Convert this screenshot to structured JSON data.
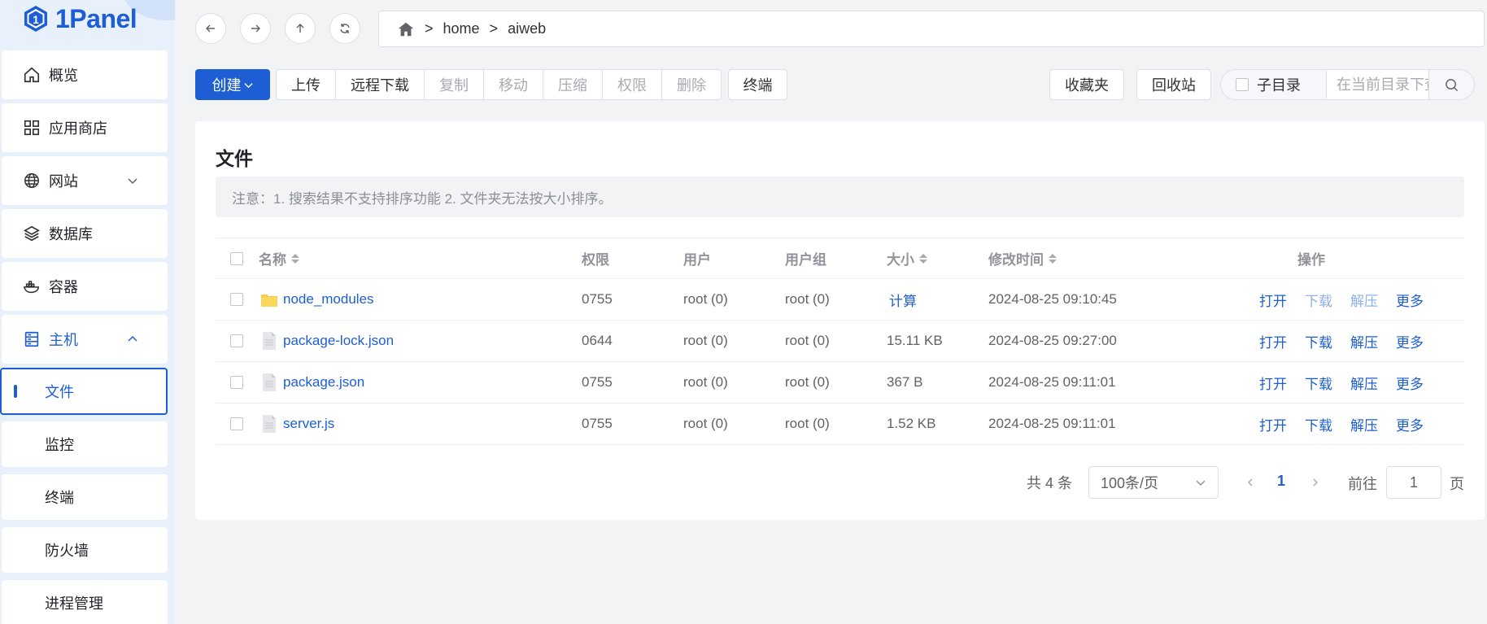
{
  "app": {
    "logo_text": "1Panel"
  },
  "sidebar": {
    "items": [
      {
        "label": "概览",
        "icon": "home-icon"
      },
      {
        "label": "应用商店",
        "icon": "grid-icon"
      },
      {
        "label": "网站",
        "icon": "globe-icon"
      },
      {
        "label": "数据库",
        "icon": "layers-icon"
      },
      {
        "label": "容器",
        "icon": "docker-icon"
      },
      {
        "label": "主机",
        "icon": "server-icon"
      }
    ],
    "sub_items": [
      "文件",
      "监控",
      "终端",
      "防火墙",
      "进程管理"
    ],
    "active": "文件"
  },
  "path": {
    "segments": [
      "home",
      "aiweb"
    ],
    "separator": ">"
  },
  "toolbar": {
    "create": "创建",
    "upload": "上传",
    "remote_download": "远程下载",
    "copy": "复制",
    "move": "移动",
    "compress": "压缩",
    "permission": "权限",
    "delete": "删除",
    "terminal": "终端",
    "favorites": "收藏夹",
    "recycle_bin": "回收站",
    "subdir": "子目录",
    "search_placeholder": "在当前目录下查找"
  },
  "card": {
    "title": "文件",
    "notice": "注意：1. 搜索结果不支持排序功能 2. 文件夹无法按大小排序。"
  },
  "table": {
    "headers": {
      "name": "名称",
      "mode": "权限",
      "user": "用户",
      "group": "用户组",
      "size": "大小",
      "mtime": "修改时间",
      "ops": "操作"
    },
    "rows": [
      {
        "name": "node_modules",
        "type": "folder",
        "mode": "0755",
        "user": "root (0)",
        "group": "root (0)",
        "size": "计算",
        "mtime": "2024-08-25 09:10:45"
      },
      {
        "name": "package-lock.json",
        "type": "file",
        "mode": "0644",
        "user": "root (0)",
        "group": "root (0)",
        "size": "15.11 KB",
        "mtime": "2024-08-25 09:27:00"
      },
      {
        "name": "package.json",
        "type": "file",
        "mode": "0755",
        "user": "root (0)",
        "group": "root (0)",
        "size": "367 B",
        "mtime": "2024-08-25 09:11:01"
      },
      {
        "name": "server.js",
        "type": "file",
        "mode": "0755",
        "user": "root (0)",
        "group": "root (0)",
        "size": "1.52 KB",
        "mtime": "2024-08-25 09:11:01"
      }
    ],
    "ops": {
      "open": "打开",
      "download": "下载",
      "extract": "解压",
      "more": "更多"
    }
  },
  "pagination": {
    "total": "共 4 条",
    "page_size": "100条/页",
    "current_page": "1",
    "goto_label": "前往",
    "goto_value": "1",
    "page_unit": "页"
  },
  "colors": {
    "primary": "#1d5ed4",
    "sidebar_bg": "#e8f0fb",
    "page_bg": "#f2f3f5"
  }
}
